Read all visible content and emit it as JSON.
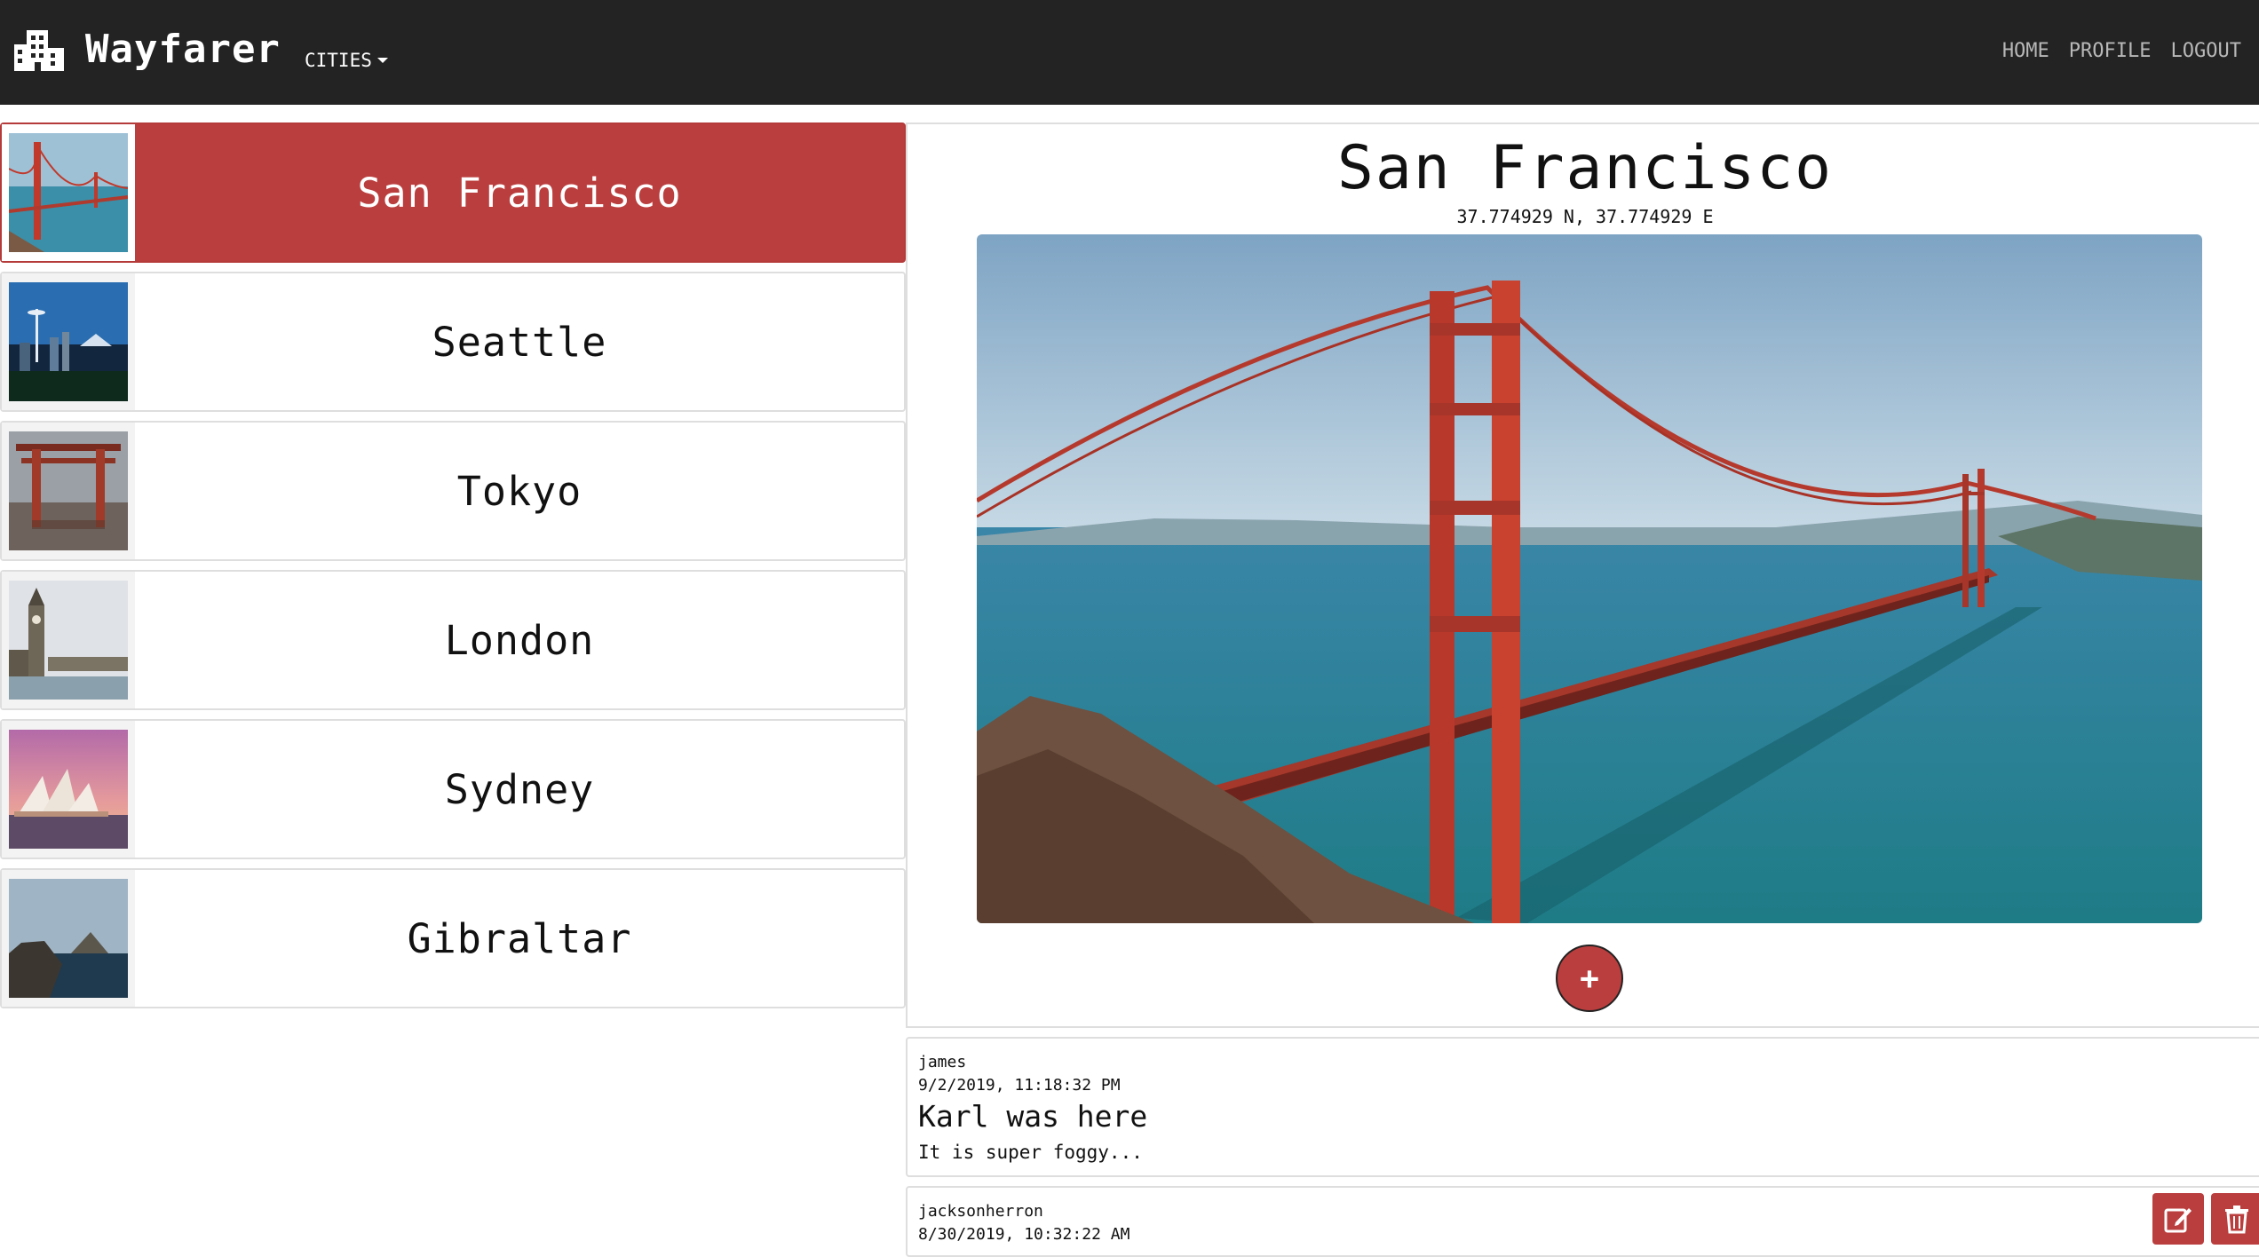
{
  "navbar": {
    "brand": "Wayfarer",
    "brand_icon": "city-buildings-icon",
    "cities_label": "CITIES",
    "links": [
      "HOME",
      "PROFILE",
      "LOGOUT"
    ]
  },
  "cities": [
    {
      "name": "San Francisco",
      "active": true
    },
    {
      "name": "Seattle",
      "active": false
    },
    {
      "name": "Tokyo",
      "active": false
    },
    {
      "name": "London",
      "active": false
    },
    {
      "name": "Sydney",
      "active": false
    },
    {
      "name": "Gibraltar",
      "active": false
    }
  ],
  "detail": {
    "title": "San Francisco",
    "coords": "37.774929 N, 37.774929 E",
    "add_label": "+"
  },
  "posts": [
    {
      "user": "james",
      "date": "9/2/2019, 11:18:32 PM",
      "title": "Karl was here",
      "body": "It is super foggy..."
    },
    {
      "user": "jacksonherron",
      "date": "8/30/2019, 10:32:22 AM",
      "title": "",
      "body": ""
    }
  ],
  "icons": {
    "edit": "edit-icon",
    "delete": "trash-icon",
    "add": "plus-icon"
  },
  "colors": {
    "accent": "#bb3e3e",
    "navbar": "#232323",
    "nav_link": "#b8b8b8"
  }
}
